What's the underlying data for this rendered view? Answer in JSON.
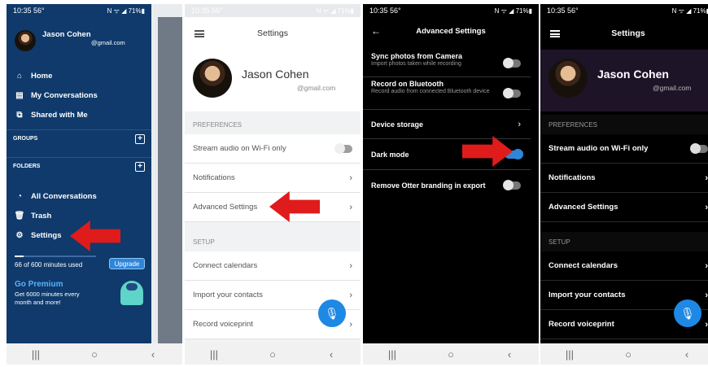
{
  "status": {
    "time": "10:35",
    "temp": "56°",
    "icons": "N ᯤ ◢ 71%▮"
  },
  "nav_buttons": [
    "|||",
    "○",
    "‹"
  ],
  "drawer": {
    "user_name": "Jason Cohen",
    "user_email": "@gmail.com",
    "items": [
      {
        "label": "Home",
        "icon": "home-icon"
      },
      {
        "label": "My Conversations",
        "icon": "conversations-icon"
      },
      {
        "label": "Shared with Me",
        "icon": "shared-icon"
      }
    ],
    "groups_label": "GROUPS",
    "folders_label": "FOLDERS",
    "folder_items": [
      {
        "label": "All Conversations",
        "icon": "all-conversations-icon"
      },
      {
        "label": "Trash",
        "icon": "trash-icon"
      },
      {
        "label": "Settings",
        "icon": "gear-icon"
      }
    ],
    "usage_text": "66 of 600 minutes used",
    "usage_fraction": 0.11,
    "upgrade_label": "Upgrade",
    "premium_title": "Go Premium",
    "premium_text": "Get 6000 minutes every month and more!"
  },
  "settings": {
    "title": "Settings",
    "user_name": "Jason Cohen",
    "user_email": "@gmail.com",
    "preferences_label": "PREFERENCES",
    "stream_audio_label": "Stream audio on Wi-Fi only",
    "stream_audio_on": false,
    "notifications_label": "Notifications",
    "advanced_label": "Advanced Settings",
    "setup_label": "SETUP",
    "connect_calendars_label": "Connect calendars",
    "import_contacts_label": "Import your contacts",
    "record_voiceprint_label": "Record voiceprint",
    "record_fab_icon": "microphone-icon"
  },
  "advanced": {
    "title": "Advanced Settings",
    "sync_photos_label": "Sync photos from Camera",
    "sync_photos_sub": "Import photos taken while recording",
    "sync_photos_on": false,
    "bluetooth_label": "Record on Bluetooth",
    "bluetooth_sub": "Record audio from connected Bluetooth device",
    "bluetooth_on": false,
    "device_storage_label": "Device storage",
    "dark_mode_label": "Dark mode",
    "dark_mode_on": true,
    "remove_branding_label": "Remove Otter branding in export",
    "remove_branding_on": false
  },
  "colors": {
    "drawer_bg": "#0f3a6b",
    "accent_blue": "#1e88e5",
    "arrow_red": "#e01b1b"
  }
}
